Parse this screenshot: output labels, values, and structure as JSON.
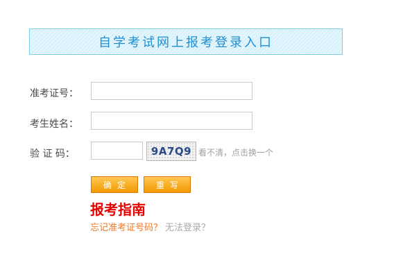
{
  "banner": {
    "title": "自学考试网上报考登录入口"
  },
  "form": {
    "exam_number_label": "准考证号：",
    "exam_number_value": "",
    "name_label": "考生姓名：",
    "name_value": "",
    "captcha_label": "验 证 码：",
    "captcha_value": "",
    "captcha_image_text": "9A7Q9",
    "captcha_hint": "看不清，点击换一个"
  },
  "buttons": {
    "confirm_label": "确定",
    "reset_label": "重写"
  },
  "links": {
    "guide": "报考指南",
    "forgot": "忘记准考证号码？",
    "cant_login": "无法登录？"
  },
  "colors": {
    "banner_text": "#1f8fd0",
    "button_orange": "#f39a00",
    "guide_red": "#e60000",
    "forgot_orange": "#f0792a"
  }
}
